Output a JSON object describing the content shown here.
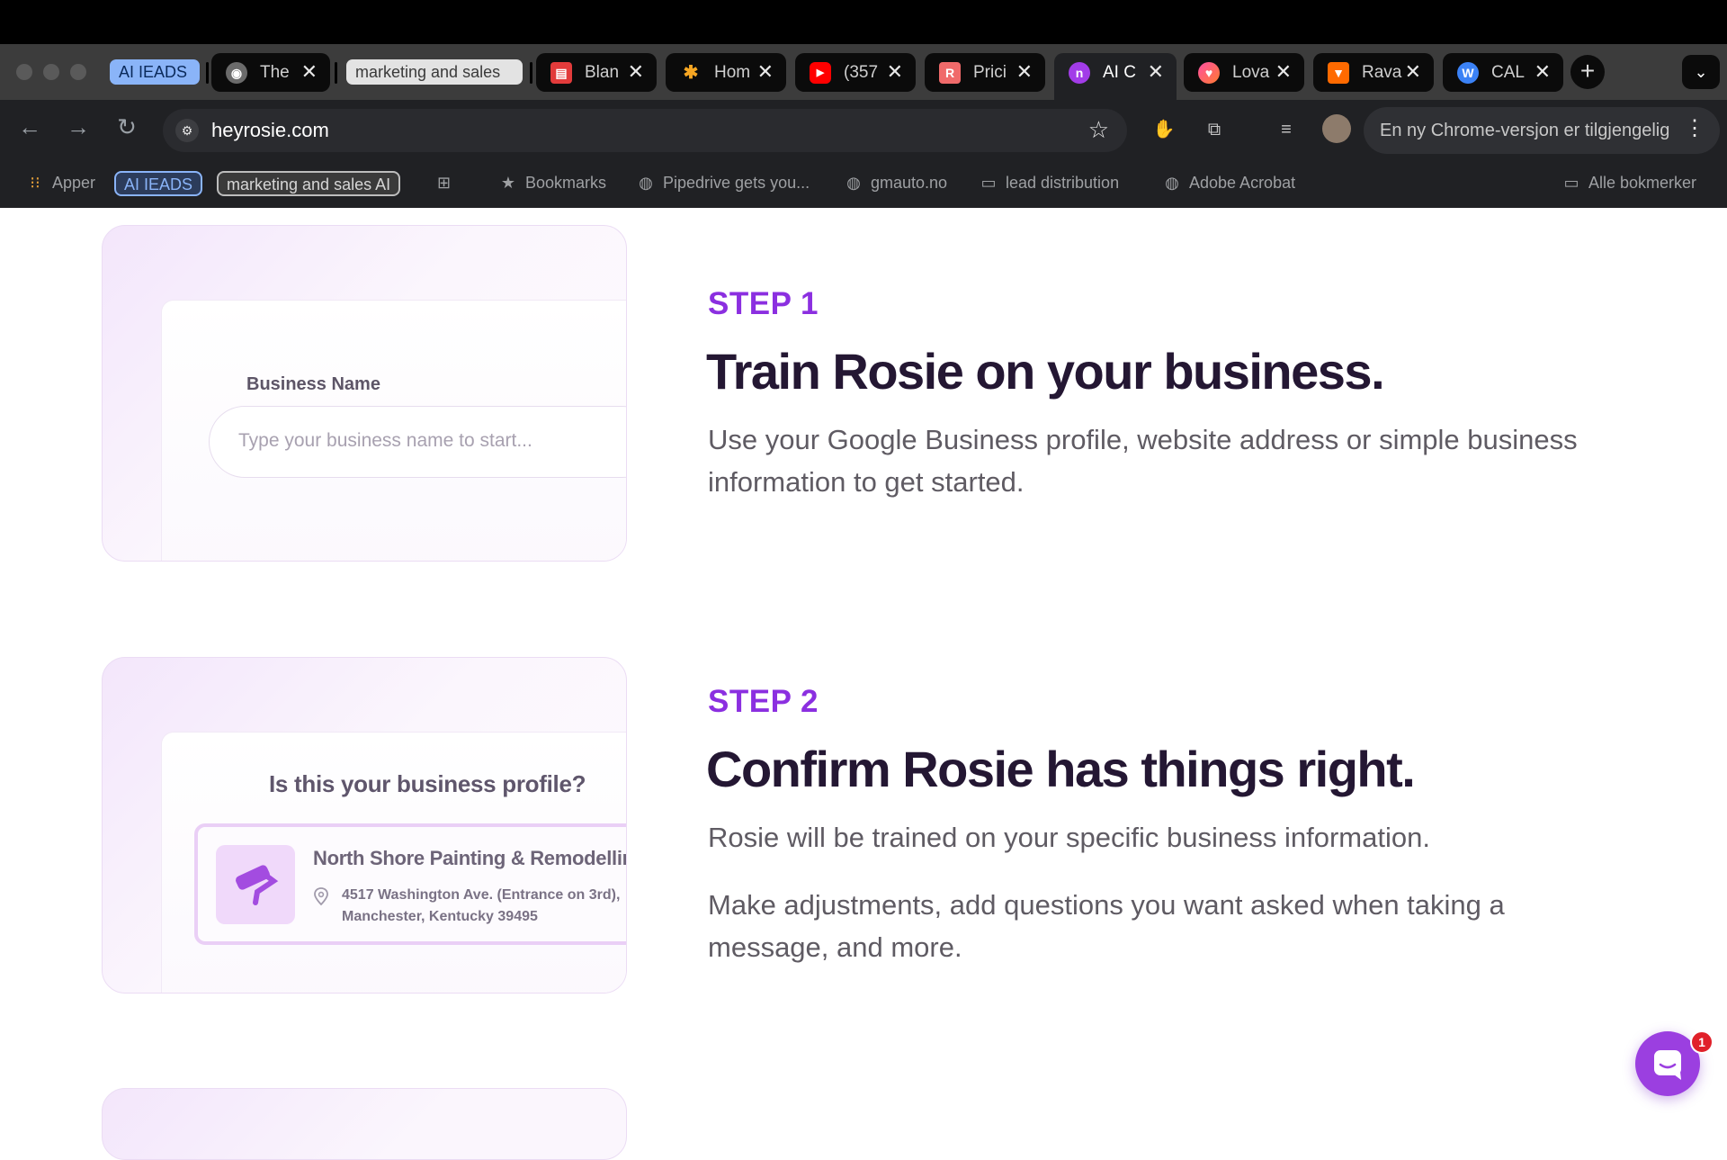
{
  "browser": {
    "tab_groups": [
      {
        "label": "AI IEADS",
        "color": "#8ab4f8"
      },
      {
        "label": "marketing and sales",
        "color": "#e0e0e0"
      }
    ],
    "tabs": [
      {
        "label": "The",
        "icon": "globe-photo-icon",
        "color": "#6b6b6b"
      },
      {
        "label": "Blan",
        "icon": "blank-doc-icon",
        "color": "#e8e8e8"
      },
      {
        "label": "Hom",
        "icon": "asterisk-icon",
        "color": "#f5a623"
      },
      {
        "label": "(357",
        "icon": "youtube-icon",
        "color": "#ff0000"
      },
      {
        "label": "Prici",
        "icon": "r-logo-icon",
        "color": "#f06a6a"
      },
      {
        "label": "AI C",
        "icon": "rosie-logo-icon",
        "color": "#a23ce8",
        "active": true
      },
      {
        "label": "Lova",
        "icon": "heart-gradient-icon",
        "color": "#ff5a4e"
      },
      {
        "label": "Rava",
        "icon": "fox-logo-icon",
        "color": "#ff6a00"
      },
      {
        "label": "CAL",
        "icon": "wordpress-icon",
        "color": "#3b82f6"
      }
    ],
    "url": "heyrosie.com",
    "update_notice": "En ny Chrome-versjon er tilgjengelig",
    "bookmarks_bar": {
      "apps": "Apper",
      "group_1": "AI IEADS",
      "group_2": "marketing and sales AI",
      "items": [
        "Bookmarks",
        "Pipedrive gets you...",
        "gmauto.no",
        "lead distribution",
        "Adobe Acrobat"
      ],
      "all_bookmarks": "Alle bokmerker"
    }
  },
  "steps": [
    {
      "tag": "STEP 1",
      "title": "Train Rosie on your business.",
      "paragraphs": [
        "Use your Google Business profile, website address or simple business information to get started."
      ],
      "preview": {
        "field_label": "Business Name",
        "placeholder": "Type your business name to start..."
      }
    },
    {
      "tag": "STEP 2",
      "title": "Confirm Rosie has things right.",
      "paragraphs": [
        "Rosie will be trained on your specific business information.",
        "Make adjustments, add questions you want asked when taking a message, and more."
      ],
      "preview": {
        "question": "Is this your business profile?",
        "business_name": "North Shore Painting & Remodelling",
        "address_line_1": "4517 Washington Ave. (Entrance on 3rd),",
        "address_line_2": "Manchester, Kentucky 39495"
      }
    }
  ],
  "chat_widget": {
    "badge_count": "1"
  }
}
